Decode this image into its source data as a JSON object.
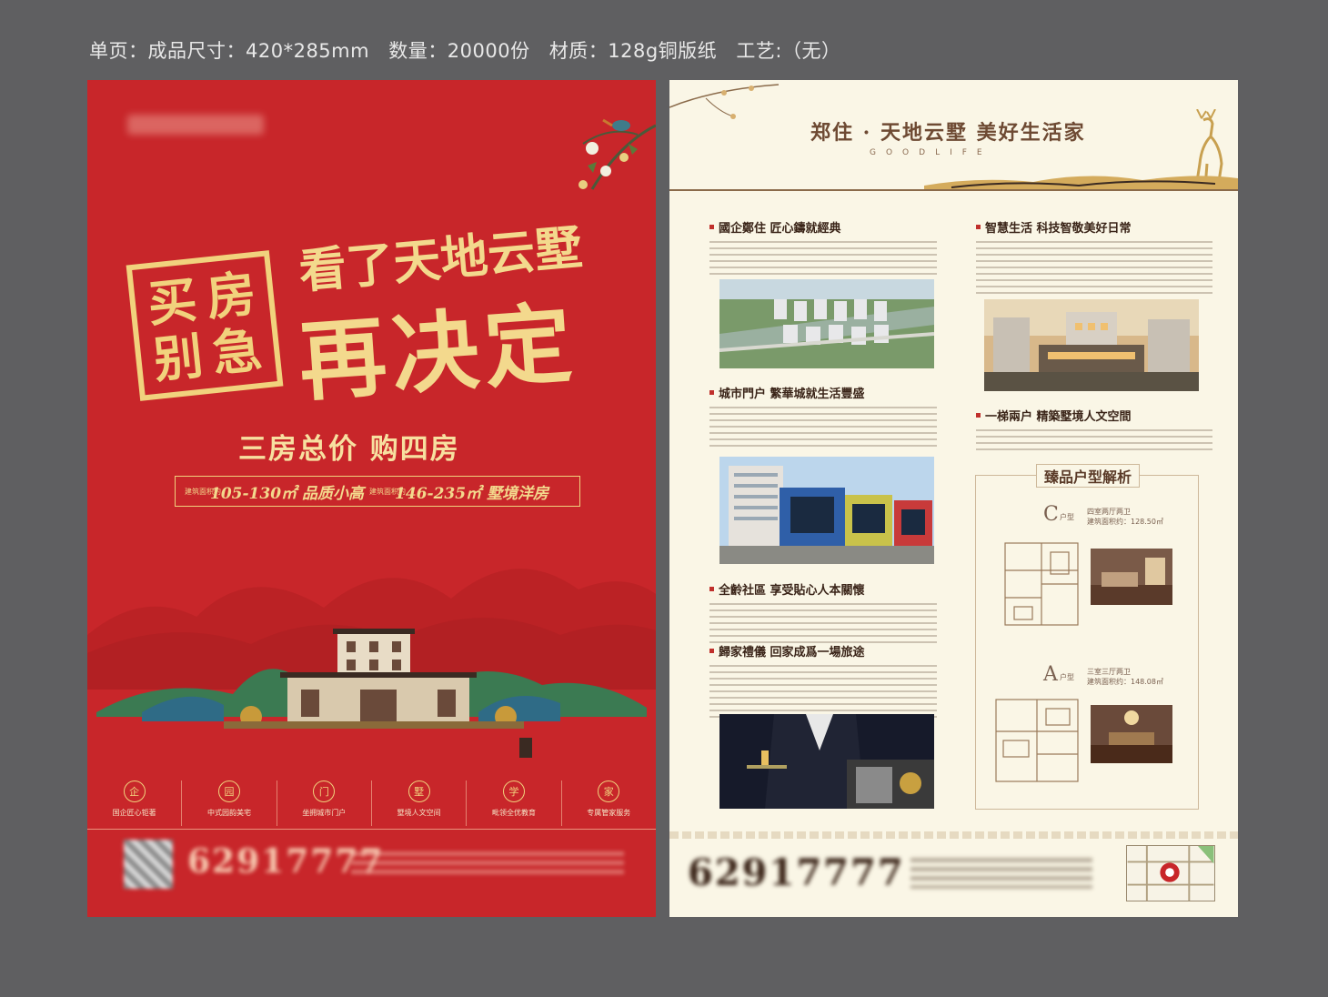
{
  "spec": {
    "page": "单页：成品尺寸：420*285mm",
    "qty": "数量：20000份",
    "material": "材质：128g铜版纸",
    "craft": "工艺:（无）"
  },
  "left": {
    "stamp": [
      "买",
      "房",
      "别",
      "急"
    ],
    "headline_line1": "看了天地云墅",
    "headline_line2": "再决定",
    "subheadline": "三房总价 购四房",
    "area_label": "建筑面积约",
    "area1": "105-130㎡",
    "type1": "品质小高",
    "area2": "146-235㎡",
    "type2": "墅境洋房",
    "features": [
      {
        "label": "国企匠心钜著",
        "icon": "企"
      },
      {
        "label": "中式园韵美宅",
        "icon": "园"
      },
      {
        "label": "坐拥城市门户",
        "icon": "门"
      },
      {
        "label": "墅境人文空间",
        "icon": "墅"
      },
      {
        "label": "毗领全优教育",
        "icon": "学"
      },
      {
        "label": "专属管家服务",
        "icon": "家"
      }
    ],
    "phone": "62917777"
  },
  "right": {
    "title": "郑住 · 天地云墅  美好生活家",
    "subtitle": "GOODLIFE",
    "sections": [
      {
        "title": "國企鄭住  匠心鑄就經典"
      },
      {
        "title": "城市門户  繁華城就生活豐盛"
      },
      {
        "title": "全齡社區  享受貼心人本關懷"
      },
      {
        "title": "歸家禮儀  回家成爲一場旅途"
      },
      {
        "title": "智慧生活  科技智敬美好日常"
      },
      {
        "title": "一梯兩户  精築墅境人文空間"
      }
    ],
    "floorplan_title": "臻品户型解析",
    "plan_c": {
      "letter": "C",
      "suffix": "户型",
      "rooms": "四室两厅两卫",
      "area": "建筑面积约：128.50㎡"
    },
    "plan_a": {
      "letter": "A",
      "suffix": "户型",
      "rooms": "三室三厅两卫",
      "area": "建筑面积约：148.08㎡"
    },
    "phone": "62917777"
  },
  "colors": {
    "red": "#c8262a",
    "gold": "#f1d27d",
    "cream": "#faf6e6",
    "background": "#5f5f61"
  }
}
